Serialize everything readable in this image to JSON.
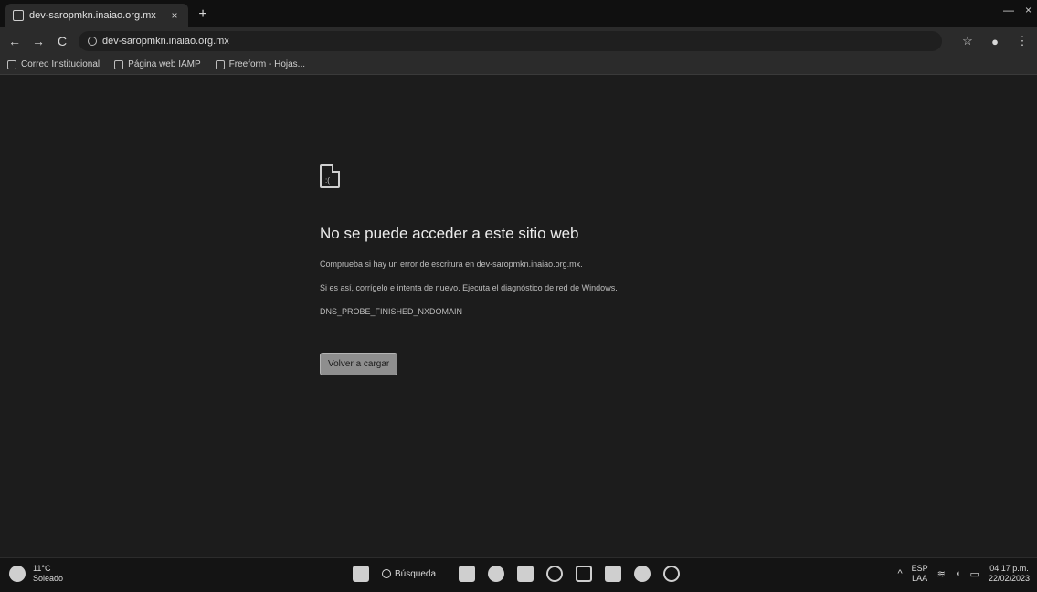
{
  "tab": {
    "title": "dev-saropmkn.inaiao.org.mx",
    "close": "×",
    "new_tab": "+"
  },
  "window": {
    "minimize": "—",
    "close": "×"
  },
  "toolbar": {
    "back": "←",
    "forward": "→",
    "reload": "C",
    "url": "dev-saropmkn.inaiao.org.mx",
    "star": "☆",
    "menu": "⋮"
  },
  "bookmarks": [
    {
      "label": "Correo Institucional"
    },
    {
      "label": "Página web IAMP"
    },
    {
      "label": "Freeform - Hojas..."
    }
  ],
  "error": {
    "title": "No se puede acceder a este sitio web",
    "line1": "Comprueba si hay un error de escritura en dev-saropmkn.inaiao.org.mx.",
    "line2": "Si es así, corrígelo e intenta de nuevo. Ejecuta el diagnóstico de red de Windows.",
    "line3": "DNS_PROBE_FINISHED_NXDOMAIN",
    "button": "Volver a cargar"
  },
  "taskbar": {
    "weather_temp": "11°C",
    "weather_desc": "Soleado",
    "search": "Búsqueda",
    "lang_top": "ESP",
    "lang_bottom": "LAA",
    "time": "04:17 p.m.",
    "date": "22/02/2023"
  }
}
